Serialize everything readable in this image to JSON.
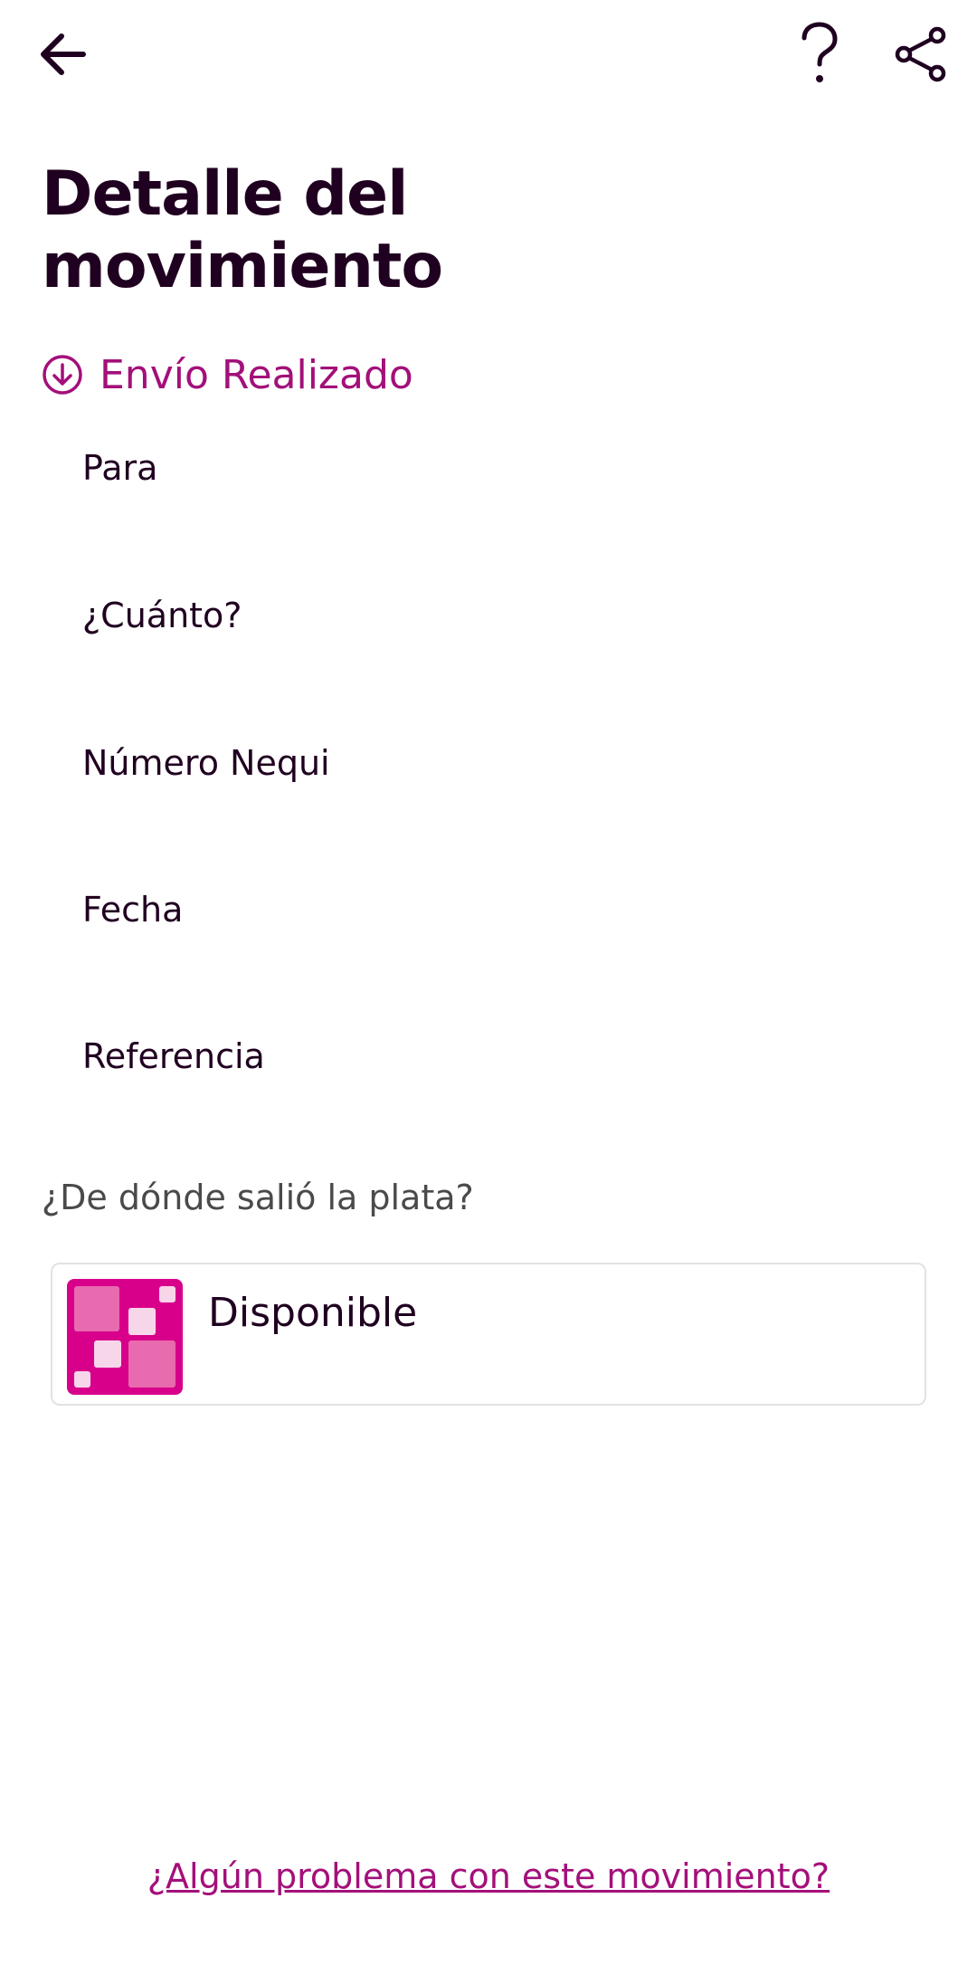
{
  "header": {
    "back_icon": "arrow-left-icon",
    "help_icon": "question-mark-icon",
    "share_icon": "share-icon"
  },
  "title": "Detalle del movimiento",
  "status": {
    "icon": "arrow-down-circle-icon",
    "label": "Envío Realizado",
    "color": "#a3107a"
  },
  "details": [
    {
      "label": "Para"
    },
    {
      "label": "¿Cuánto?"
    },
    {
      "label": "Número Nequi"
    },
    {
      "label": "Fecha"
    },
    {
      "label": "Referencia"
    }
  ],
  "source": {
    "question": "¿De dónde salió la plata?",
    "account_name": "Disponible",
    "logo_color": "#d8008b"
  },
  "footer": {
    "problem_link": "¿Algún problema con este movimiento?"
  },
  "colors": {
    "accent": "#a3107a",
    "text": "#200020"
  }
}
